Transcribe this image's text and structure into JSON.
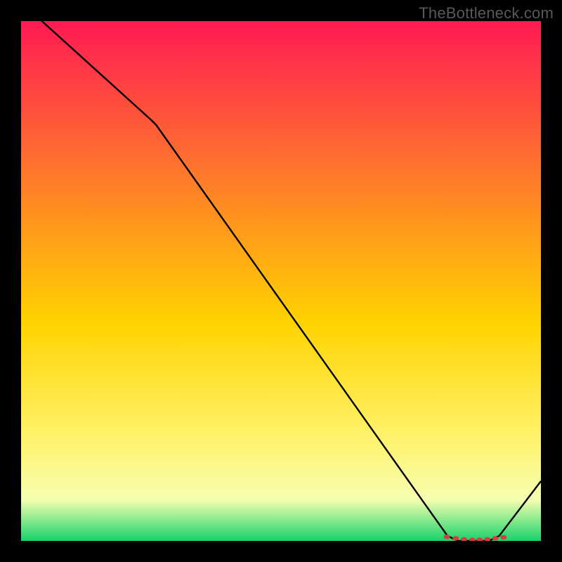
{
  "attribution": "TheBottleneck.com",
  "colors": {
    "black": "#000000",
    "line": "#000000",
    "marker": "#d63c3c",
    "grad_top": "#ff1a52",
    "grad_mid1": "#ff7a2a",
    "grad_mid2": "#ffd300",
    "grad_mid3": "#fff26b",
    "grad_mid4": "#f6ffb0",
    "grad_bottom": "#18d36b"
  },
  "chart_data": {
    "type": "line",
    "title": "",
    "xlabel": "",
    "ylabel": "",
    "xlim": [
      0,
      1000
    ],
    "ylim": [
      0,
      1000
    ],
    "x": [
      0,
      40,
      250,
      260,
      820,
      840,
      900,
      920,
      1000
    ],
    "values": [
      1035,
      1000,
      810,
      800,
      10,
      0,
      0,
      10,
      115
    ],
    "markers_x": [
      819,
      836,
      852,
      868,
      882,
      897,
      912,
      928
    ],
    "markers_y": [
      8,
      5,
      3,
      2,
      2,
      3,
      5,
      7
    ],
    "grid": false,
    "legend": false
  }
}
